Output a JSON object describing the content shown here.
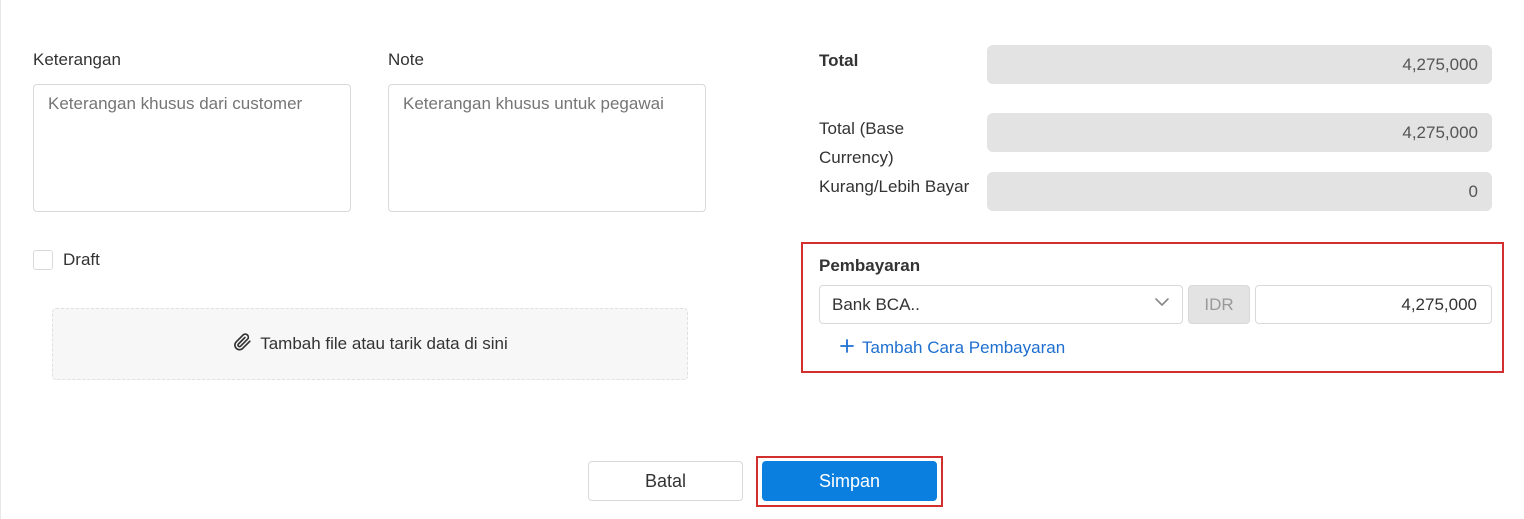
{
  "form": {
    "keterangan": {
      "label": "Keterangan",
      "placeholder": "Keterangan khusus dari customer",
      "value": ""
    },
    "note": {
      "label": "Note",
      "placeholder": "Keterangan khusus untuk pegawai",
      "value": ""
    },
    "draft": {
      "label": "Draft",
      "checked": false
    },
    "attachment": {
      "label": "Tambah file atau tarik data di sini",
      "icon": "paperclip-icon"
    }
  },
  "summary": {
    "total": {
      "label": "Total",
      "value": "4,275,000"
    },
    "total_base": {
      "label_line1": "Total (Base",
      "label_line2": "Currency)",
      "value": "4,275,000"
    },
    "kurang_lebih": {
      "label": "Kurang/Lebih Bayar",
      "value": "0"
    }
  },
  "payment": {
    "title": "Pembayaran",
    "method": "Bank BCA..",
    "currency": "IDR",
    "amount": "4,275,000",
    "add_label": "Tambah Cara Pembayaran",
    "highlight_color": "#d32f2f"
  },
  "actions": {
    "cancel_label": "Batal",
    "save_label": "Simpan",
    "save_color": "#0a7fe0"
  }
}
